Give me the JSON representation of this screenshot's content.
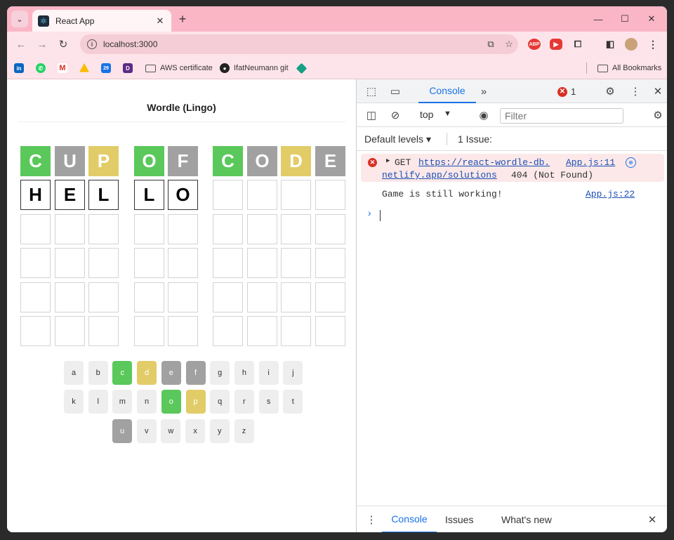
{
  "browser": {
    "tab_title": "React App",
    "url": "localhost:3000",
    "bookmarks": [
      {
        "label": "AWS certificate"
      },
      {
        "label": "IfatNeumann git"
      }
    ],
    "all_bookmarks": "All Bookmarks"
  },
  "game": {
    "title": "Wordle (Lingo)",
    "solution_row": [
      {
        "letter": "C",
        "state": "green"
      },
      {
        "letter": "U",
        "state": "grey"
      },
      {
        "letter": "P",
        "state": "yellow"
      },
      {
        "letter": "O",
        "state": "green"
      },
      {
        "letter": "F",
        "state": "grey"
      },
      {
        "letter": "C",
        "state": "green"
      },
      {
        "letter": "O",
        "state": "grey"
      },
      {
        "letter": "D",
        "state": "yellow"
      },
      {
        "letter": "E",
        "state": "grey"
      }
    ],
    "typed_row": [
      "H",
      "E",
      "L",
      "L",
      "O",
      "",
      "",
      "",
      ""
    ],
    "keyboard": [
      [
        {
          "k": "a",
          "s": ""
        },
        {
          "k": "b",
          "s": ""
        },
        {
          "k": "c",
          "s": "green"
        },
        {
          "k": "d",
          "s": "yellow"
        },
        {
          "k": "e",
          "s": "grey"
        },
        {
          "k": "f",
          "s": "grey"
        },
        {
          "k": "g",
          "s": ""
        },
        {
          "k": "h",
          "s": ""
        },
        {
          "k": "i",
          "s": ""
        },
        {
          "k": "j",
          "s": ""
        }
      ],
      [
        {
          "k": "k",
          "s": ""
        },
        {
          "k": "l",
          "s": ""
        },
        {
          "k": "m",
          "s": ""
        },
        {
          "k": "n",
          "s": ""
        },
        {
          "k": "o",
          "s": "green"
        },
        {
          "k": "p",
          "s": "yellow"
        },
        {
          "k": "q",
          "s": ""
        },
        {
          "k": "r",
          "s": ""
        },
        {
          "k": "s",
          "s": ""
        },
        {
          "k": "t",
          "s": ""
        }
      ],
      [
        {
          "k": "u",
          "s": "grey"
        },
        {
          "k": "v",
          "s": ""
        },
        {
          "k": "w",
          "s": ""
        },
        {
          "k": "x",
          "s": ""
        },
        {
          "k": "y",
          "s": ""
        },
        {
          "k": "z",
          "s": ""
        }
      ]
    ]
  },
  "devtools": {
    "active_tab": "Console",
    "error_count": "1",
    "context": "top",
    "filter_placeholder": "Filter",
    "levels": "Default levels",
    "issues": "1 Issue:",
    "error": {
      "method": "GET",
      "url_part1": "https://react-wordle-db.",
      "url_part2": "netlify.app/solutions",
      "status": "404 (Not Found)",
      "source": "App.js:11"
    },
    "log": {
      "message": "Game is still working!",
      "source": "App.js:22"
    },
    "drawer_tabs": [
      "Console",
      "Issues",
      "What's new"
    ]
  }
}
